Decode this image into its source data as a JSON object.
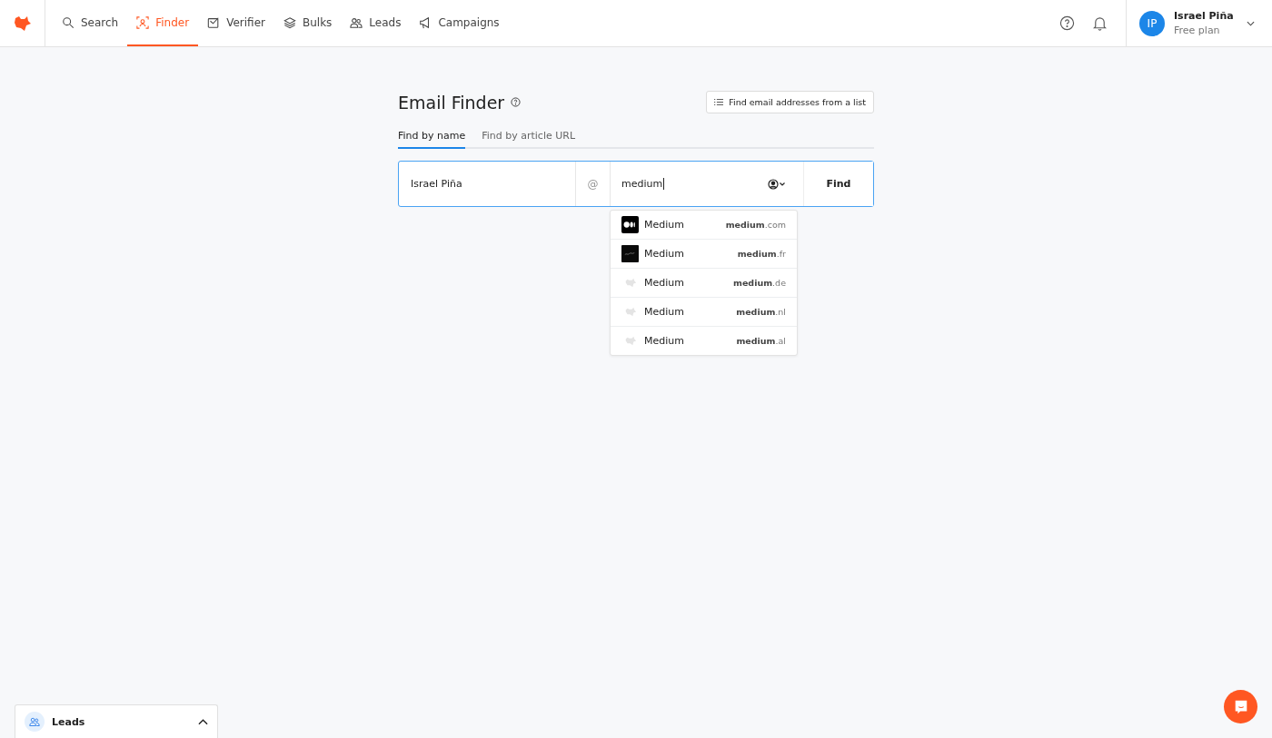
{
  "nav": {
    "items": [
      {
        "label": "Search",
        "selected": false
      },
      {
        "label": "Finder",
        "selected": true
      },
      {
        "label": "Verifier",
        "selected": false
      },
      {
        "label": "Bulks",
        "selected": false
      },
      {
        "label": "Leads",
        "selected": false
      },
      {
        "label": "Campaigns",
        "selected": false
      }
    ],
    "user": {
      "initials": "IP",
      "name": "Israel Piña",
      "plan": "Free plan"
    }
  },
  "page": {
    "title": "Email Finder",
    "list_button": "Find email addresses from a list",
    "tabs": [
      {
        "label": "Find by name",
        "selected": true
      },
      {
        "label": "Find by article URL",
        "selected": false
      }
    ],
    "form": {
      "name_value": "Israel Piña",
      "at": "@",
      "domain_value": "medium",
      "button": "Find"
    },
    "suggestions": [
      {
        "name": "Medium",
        "domain": "**medium**.com",
        "kind": "medium-logo"
      },
      {
        "name": "Medium",
        "domain": "**medium**.fr",
        "kind": "dark-logo"
      },
      {
        "name": "Medium",
        "domain": "**medium**.de",
        "kind": "placeholder"
      },
      {
        "name": "Medium",
        "domain": "**medium**.nl",
        "kind": "placeholder"
      },
      {
        "name": "Medium",
        "domain": "**medium**.al",
        "kind": "placeholder"
      }
    ]
  },
  "leads_panel": {
    "label": "Leads",
    "expanded": false
  }
}
